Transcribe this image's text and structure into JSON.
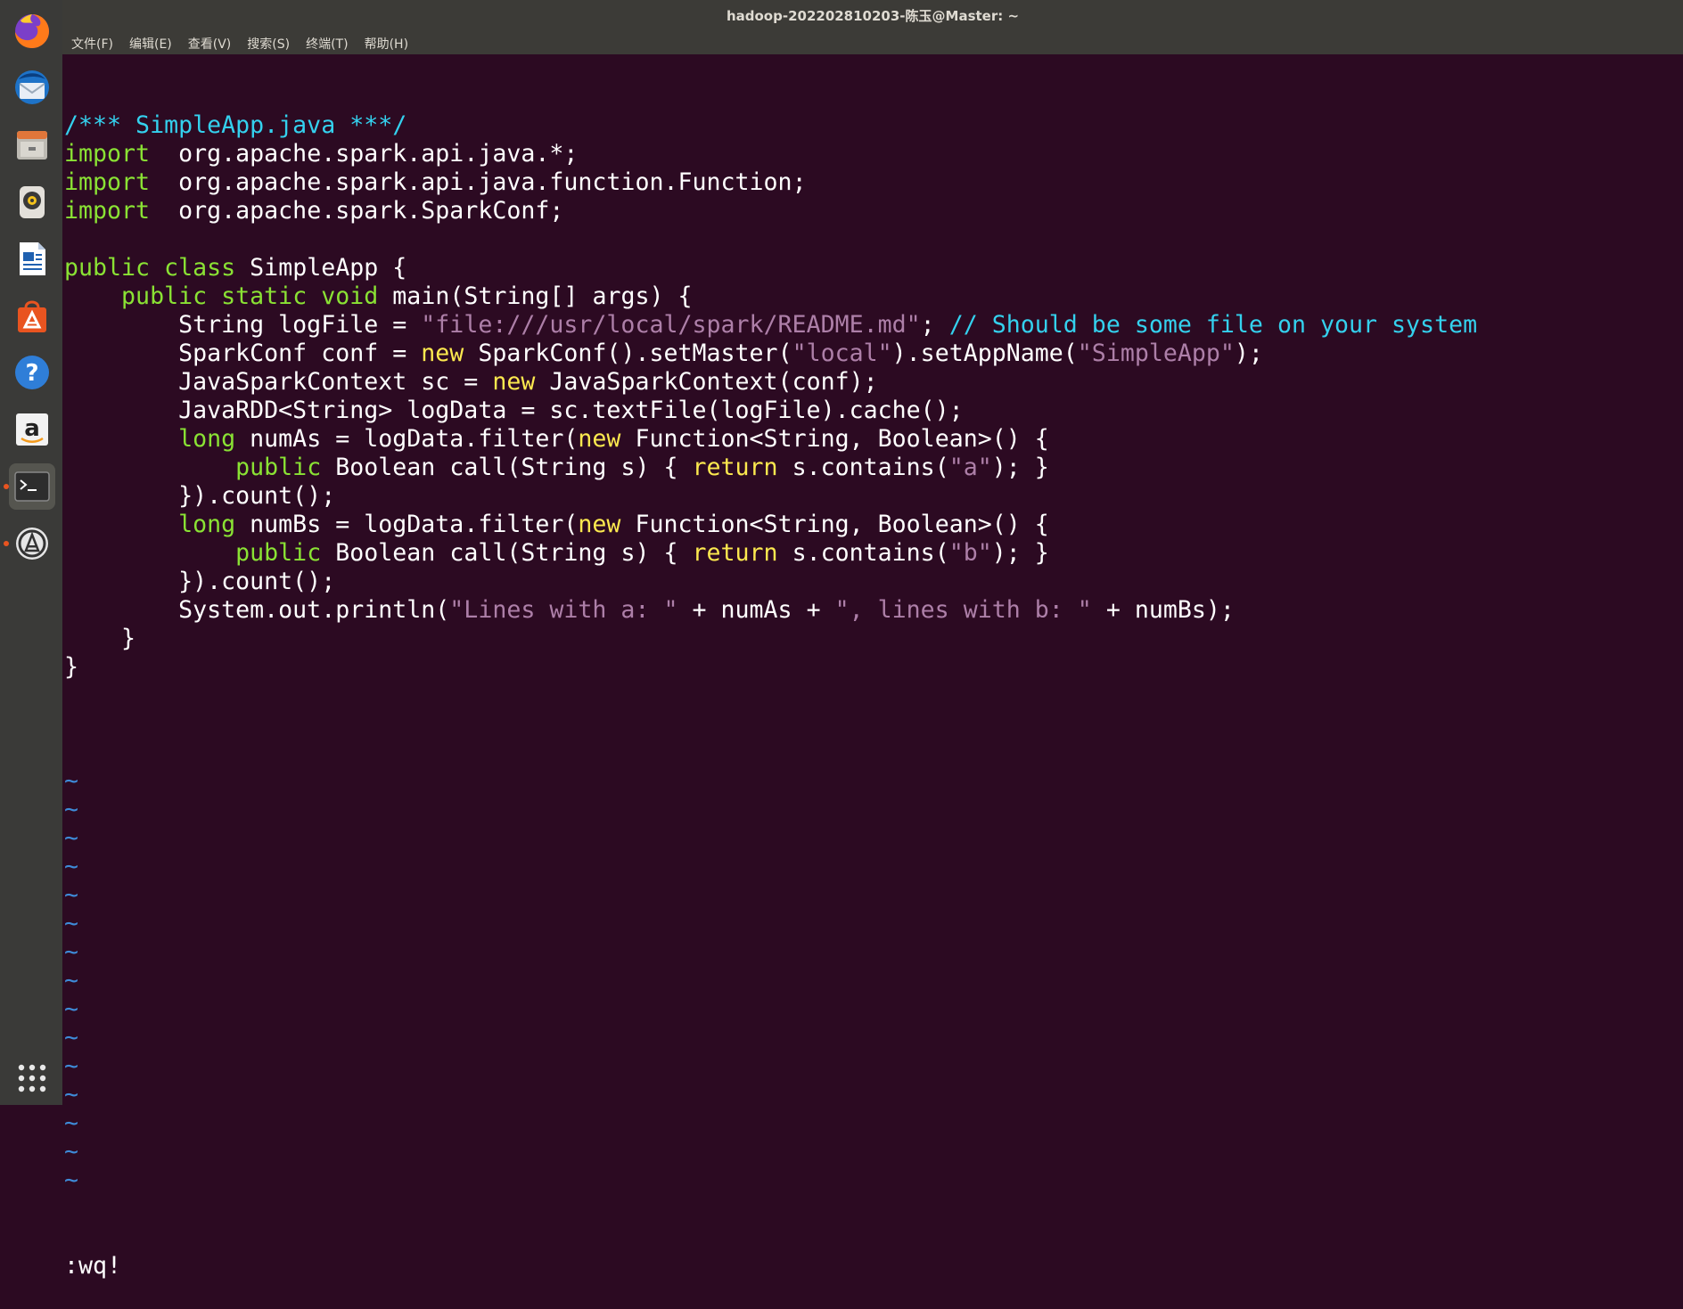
{
  "window": {
    "title": "hadoop-202202810203-陈玉@Master: ~"
  },
  "menu": [
    "文件(F)",
    "编辑(E)",
    "查看(V)",
    "搜索(S)",
    "终端(T)",
    "帮助(H)"
  ],
  "launcher": [
    {
      "name": "firefox-icon"
    },
    {
      "name": "thunderbird-icon"
    },
    {
      "name": "files-icon"
    },
    {
      "name": "rhythmbox-icon"
    },
    {
      "name": "libreoffice-writer-icon"
    },
    {
      "name": "software-center-icon"
    },
    {
      "name": "help-icon"
    },
    {
      "name": "amazon-icon"
    },
    {
      "name": "terminal-icon"
    },
    {
      "name": "software-updater-icon"
    },
    {
      "name": "show-apps-icon"
    }
  ],
  "code": [
    [
      [
        "c-comment",
        "/*** SimpleApp.java ***/"
      ]
    ],
    [
      [
        "c-key",
        "import"
      ],
      [
        "",
        "  org.apache.spark.api.java.*;"
      ]
    ],
    [
      [
        "c-key",
        "import"
      ],
      [
        "",
        "  org.apache.spark.api.java.function.Function;"
      ]
    ],
    [
      [
        "c-key",
        "import"
      ],
      [
        "",
        "  org.apache.spark.SparkConf;"
      ]
    ],
    [],
    [
      [
        "c-key",
        "public"
      ],
      [
        "",
        " "
      ],
      [
        "c-key",
        "class"
      ],
      [
        "",
        " SimpleApp {"
      ]
    ],
    [
      [
        "",
        "    "
      ],
      [
        "c-key",
        "public"
      ],
      [
        "",
        " "
      ],
      [
        "c-key",
        "static"
      ],
      [
        "",
        " "
      ],
      [
        "c-key",
        "void"
      ],
      [
        "",
        " main(String[] args) {"
      ]
    ],
    [
      [
        "",
        "        String logFile = "
      ],
      [
        "c-str",
        "\"file:///usr/local/spark/README.md\""
      ],
      [
        "",
        "; "
      ],
      [
        "c-comment",
        "// Should be some file on your system"
      ]
    ],
    [
      [
        "",
        "        SparkConf conf = "
      ],
      [
        "c-yel",
        "new"
      ],
      [
        "",
        " SparkConf().setMaster("
      ],
      [
        "c-str",
        "\"local\""
      ],
      [
        "",
        ").setAppName("
      ],
      [
        "c-str",
        "\"SimpleApp\""
      ],
      [
        "",
        ");"
      ]
    ],
    [
      [
        "",
        "        JavaSparkContext sc = "
      ],
      [
        "c-yel",
        "new"
      ],
      [
        "",
        " JavaSparkContext(conf);"
      ]
    ],
    [
      [
        "",
        "        JavaRDD<String> logData = sc.textFile(logFile).cache();"
      ]
    ],
    [
      [
        "",
        "        "
      ],
      [
        "c-key",
        "long"
      ],
      [
        "",
        " numAs = logData.filter("
      ],
      [
        "c-yel",
        "new"
      ],
      [
        "",
        " Function<String, Boolean>() {"
      ]
    ],
    [
      [
        "",
        "            "
      ],
      [
        "c-key",
        "public"
      ],
      [
        "",
        " Boolean call(String s) { "
      ],
      [
        "c-yel",
        "return"
      ],
      [
        "",
        " s.contains("
      ],
      [
        "c-str",
        "\"a\""
      ],
      [
        "",
        "); }"
      ]
    ],
    [
      [
        "",
        "        }).count();"
      ]
    ],
    [
      [
        "",
        "        "
      ],
      [
        "c-key",
        "long"
      ],
      [
        "",
        " numBs = logData.filter("
      ],
      [
        "c-yel",
        "new"
      ],
      [
        "",
        " Function<String, Boolean>() {"
      ]
    ],
    [
      [
        "",
        "            "
      ],
      [
        "c-key",
        "public"
      ],
      [
        "",
        " Boolean call(String s) { "
      ],
      [
        "c-yel",
        "return"
      ],
      [
        "",
        " s.contains("
      ],
      [
        "c-str",
        "\"b\""
      ],
      [
        "",
        "); }"
      ]
    ],
    [
      [
        "",
        "        }).count();"
      ]
    ],
    [
      [
        "",
        "        System.out.println("
      ],
      [
        "c-str",
        "\"Lines with a: \""
      ],
      [
        "",
        " + numAs + "
      ],
      [
        "c-str",
        "\", lines with b: \""
      ],
      [
        "",
        " + numBs);"
      ]
    ],
    [
      [
        "",
        "    }"
      ]
    ],
    [
      [
        "",
        "}"
      ]
    ],
    []
  ],
  "tilde_count": 15,
  "tilde_char": "~",
  "command_line": ":wq!"
}
